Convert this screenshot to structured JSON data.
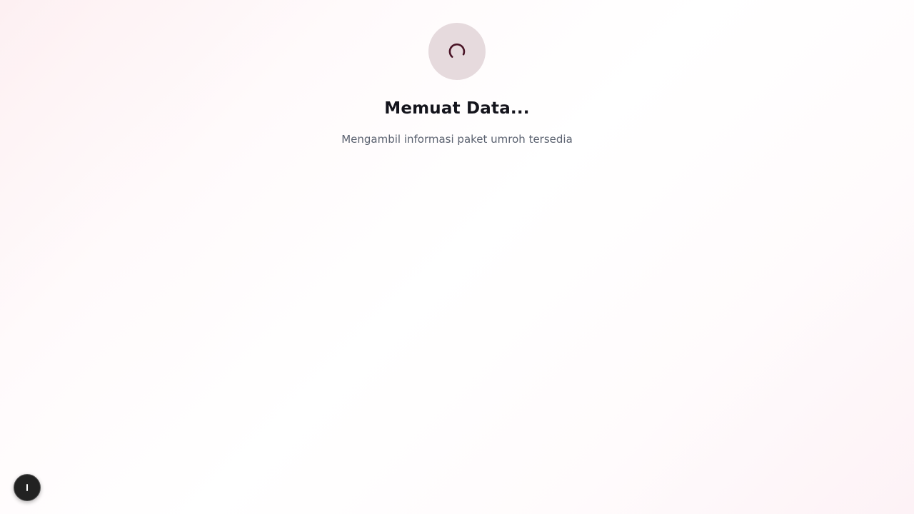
{
  "loading": {
    "title": "Memuat Data...",
    "subtitle": "Mengambil informasi paket umroh tersedia",
    "icon": "spinner-icon"
  },
  "floating_button": {
    "icon": "dev-tools-icon"
  },
  "colors": {
    "spinner_bg": "#e6dadd",
    "spinner_stroke": "#4a1426",
    "title": "#14141c",
    "subtitle": "#5b6270",
    "floating_button_bg": "#222222"
  }
}
